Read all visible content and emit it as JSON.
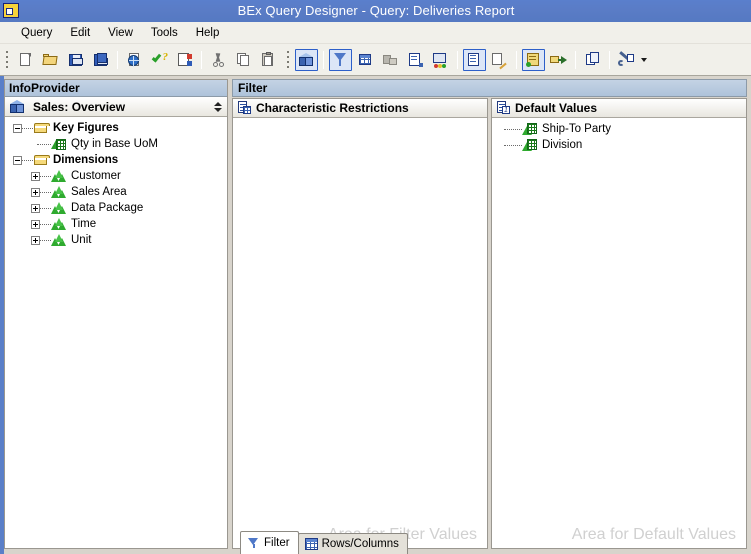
{
  "window": {
    "title": "BEx Query Designer - Query: Deliveries Report",
    "app_icon": "query-designer-icon"
  },
  "menu": {
    "items": [
      {
        "label": "Query",
        "name": "menu-query"
      },
      {
        "label": "Edit",
        "name": "menu-edit"
      },
      {
        "label": "View",
        "name": "menu-view"
      },
      {
        "label": "Tools",
        "name": "menu-tools"
      },
      {
        "label": "Help",
        "name": "menu-help"
      }
    ]
  },
  "toolbar": {
    "groups": [
      {
        "buttons": [
          {
            "icon": "new-query-icon",
            "name": "new-query-button",
            "selected": false
          },
          {
            "icon": "open-query-icon",
            "name": "open-query-button",
            "selected": false
          },
          {
            "icon": "save-query-icon",
            "name": "save-query-button",
            "selected": false
          },
          {
            "icon": "save-as-icon",
            "name": "save-as-button",
            "selected": false
          },
          {
            "sep": true
          },
          {
            "icon": "publish-web-icon",
            "name": "publish-button",
            "selected": false
          },
          {
            "icon": "check-query-icon",
            "name": "check-query-button",
            "selected": false
          },
          {
            "icon": "query-properties-icon",
            "name": "query-properties-button",
            "selected": false
          },
          {
            "sep": true
          },
          {
            "icon": "cut-icon",
            "name": "cut-button",
            "selected": false
          },
          {
            "icon": "copy-icon",
            "name": "copy-button",
            "selected": false
          },
          {
            "icon": "paste-icon",
            "name": "paste-button",
            "selected": false
          }
        ]
      },
      {
        "buttons": [
          {
            "icon": "infoprovider-cube-icon",
            "name": "toggle-infoprovider-button",
            "selected": true
          },
          {
            "sep": true
          },
          {
            "icon": "filter-funnel-icon",
            "name": "toggle-filter-button",
            "selected": true
          },
          {
            "icon": "rows-columns-icon",
            "name": "toggle-rows-columns-button",
            "selected": false
          },
          {
            "icon": "cell-definition-icon",
            "name": "cell-definition-button",
            "selected": false
          },
          {
            "icon": "properties-pane-icon",
            "name": "toggle-properties-button",
            "selected": false
          },
          {
            "icon": "messages-icon",
            "name": "toggle-messages-button",
            "selected": false
          },
          {
            "sep": true
          },
          {
            "icon": "task-pane-icon",
            "name": "toggle-task-pane-button",
            "selected": true
          },
          {
            "icon": "edit-note-icon",
            "name": "edit-note-button",
            "selected": false
          },
          {
            "sep": true
          },
          {
            "icon": "document-list-icon",
            "name": "document-list-button",
            "selected": true
          },
          {
            "icon": "export-icon",
            "name": "export-button",
            "selected": false
          },
          {
            "sep": true
          },
          {
            "icon": "exchange-icon",
            "name": "exchange-button",
            "selected": false
          },
          {
            "sep": true
          },
          {
            "icon": "settings-wrench-icon",
            "name": "settings-button",
            "selected": false
          },
          {
            "caret": true,
            "name": "toolbar-overflow-caret"
          }
        ]
      }
    ]
  },
  "infoprovider": {
    "pane_title": "InfoProvider",
    "provider_name": "Sales: Overview",
    "provider_icon": "infocube-icon",
    "tree": [
      {
        "label": "Key Figures",
        "icon": "folder-icon",
        "level": 0,
        "bold": true,
        "expander": "minus",
        "name": "tree-node-key-figures"
      },
      {
        "label": "Qty in Base UoM",
        "icon": "key-figure-icon",
        "level": 1,
        "bold": false,
        "expander": "none",
        "name": "tree-node-qty-in-base-uom"
      },
      {
        "label": "Dimensions",
        "icon": "folder-icon",
        "level": 0,
        "bold": true,
        "expander": "minus",
        "name": "tree-node-dimensions"
      },
      {
        "label": "Customer",
        "icon": "dimension-icon",
        "level": 1,
        "bold": false,
        "expander": "plus",
        "name": "tree-node-customer"
      },
      {
        "label": "Sales Area",
        "icon": "dimension-icon",
        "level": 1,
        "bold": false,
        "expander": "plus",
        "name": "tree-node-sales-area"
      },
      {
        "label": "Data Package",
        "icon": "dimension-icon",
        "level": 1,
        "bold": false,
        "expander": "plus",
        "name": "tree-node-data-package"
      },
      {
        "label": "Time",
        "icon": "dimension-icon",
        "level": 1,
        "bold": false,
        "expander": "plus",
        "name": "tree-node-time"
      },
      {
        "label": "Unit",
        "icon": "dimension-icon",
        "level": 1,
        "bold": false,
        "expander": "plus",
        "name": "tree-node-unit"
      }
    ]
  },
  "filter": {
    "pane_title": "Filter",
    "characteristic_restrictions": {
      "title": "Characteristic Restrictions",
      "icon": "characteristic-restrictions-icon",
      "items": [],
      "watermark": "Area for Filter Values"
    },
    "default_values": {
      "title": "Default Values",
      "icon": "default-values-icon",
      "items": [
        {
          "label": "Ship-To Party",
          "icon": "characteristic-icon",
          "name": "default-value-ship-to-party"
        },
        {
          "label": "Division",
          "icon": "characteristic-icon",
          "name": "default-value-division"
        }
      ],
      "watermark": "Area for Default Values"
    }
  },
  "tabs": {
    "items": [
      {
        "label": "Filter",
        "icon": "funnel-icon",
        "active": true,
        "name": "tab-filter"
      },
      {
        "label": "Rows/Columns",
        "icon": "grid-icon",
        "active": false,
        "name": "tab-rows-columns"
      }
    ]
  },
  "colors": {
    "titlebar": "#577ac4",
    "pane_header": "#b8cade",
    "toolbar_bg": "#f1f0ea",
    "selection_border": "#2d5fc9",
    "watermark_text": "#d0d0d0",
    "green_accent": "#2faa2f",
    "blue_accent": "#3b63b0"
  }
}
